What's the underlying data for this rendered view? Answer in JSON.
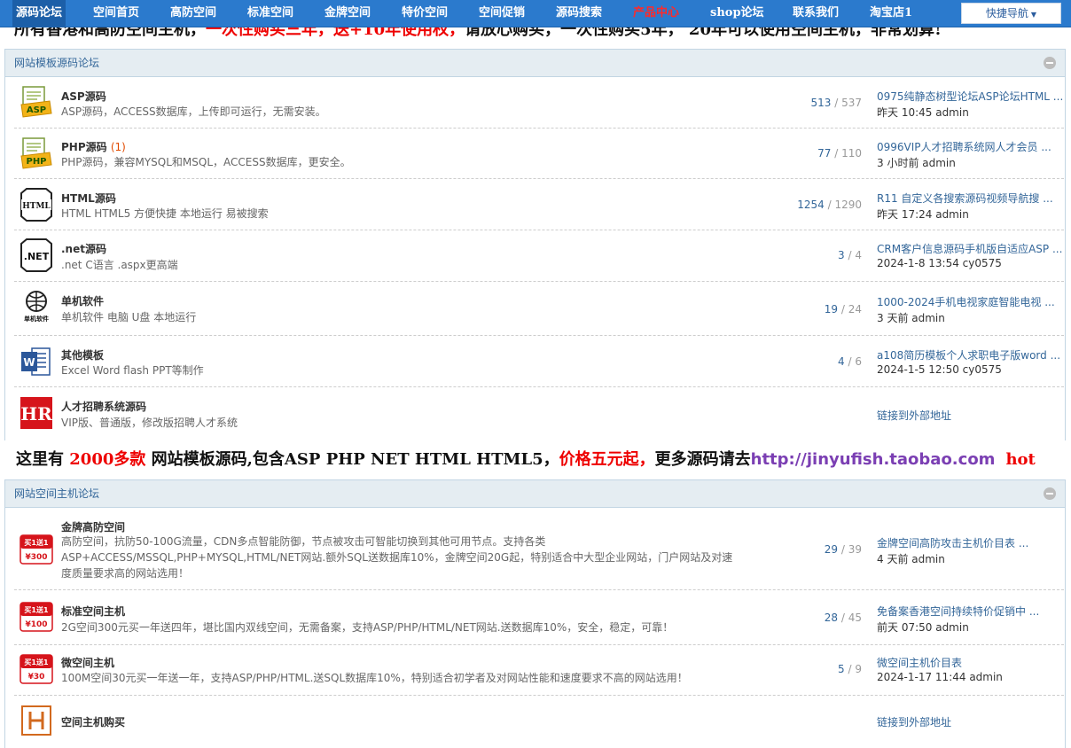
{
  "nav": {
    "items": [
      {
        "label": "源码论坛",
        "active": true
      },
      {
        "label": "空间首页"
      },
      {
        "label": "高防空间"
      },
      {
        "label": "标准空间"
      },
      {
        "label": "金牌空间"
      },
      {
        "label": "特价空间"
      },
      {
        "label": "空间促销"
      },
      {
        "label": "源码搜索"
      },
      {
        "label": "产品中心",
        "hot": true
      },
      {
        "label": "shop论坛"
      },
      {
        "label": "联系我们"
      },
      {
        "label": "淘宝店1"
      }
    ],
    "quick_nav_label": "快捷导航"
  },
  "banner1": {
    "part1": "所有香港和高防空间主机，",
    "part2": "一次性购买三年，送+10年使用权，",
    "part3": "请放心购买，一次性购买5年， 20年可以使用空间主机，非常划算!"
  },
  "section1": {
    "title": "网站模板源码论坛",
    "forums": [
      {
        "icon": "asp-icon",
        "name": "ASP源码",
        "desc": "ASP源码，ACCESS数据库，上传即可运行，无需安装。",
        "threads": "513",
        "posts": "537",
        "last_title": "0975纯静态树型论坛ASP论坛HTML ...",
        "last_meta": "昨天 10:45 admin"
      },
      {
        "icon": "php-icon",
        "name": "PHP源码",
        "count": "(1)",
        "desc": "PHP源码，兼容MYSQL和MSQL，ACCESS数据库，更安全。",
        "threads": "77",
        "posts": "110",
        "last_title": "0996VIP人才招聘系统网人才会员 ...",
        "last_meta": "3 小时前 admin"
      },
      {
        "icon": "html-icon",
        "name": "HTML源码",
        "desc": "HTML HTML5 方便快捷 本地运行 易被搜索",
        "threads": "1254",
        "posts": "1290",
        "last_title": "R11 自定义各搜索源码视频导航搜 ...",
        "last_meta": "昨天 17:24 admin"
      },
      {
        "icon": "net-icon",
        "name": ".net源码",
        "desc": ".net C语言 .aspx更高端",
        "threads": "3",
        "posts": "4",
        "last_title": "CRM客户信息源码手机版自适应ASP ...",
        "last_meta": "2024-1-8 13:54 cy0575"
      },
      {
        "icon": "software-icon",
        "name": "单机软件",
        "desc": "单机软件 电脑 U盘 本地运行",
        "threads": "19",
        "posts": "24",
        "last_title": "1000-2024手机电视家庭智能电视 ...",
        "last_meta": "3 天前 admin"
      },
      {
        "icon": "word-icon",
        "name": "其他模板",
        "desc": "Excel Word flash PPT等制作",
        "threads": "4",
        "posts": "6",
        "last_title": "a108简历模板个人求职电子版word ...",
        "last_meta": "2024-1-5 12:50 cy0575"
      },
      {
        "icon": "hr-icon",
        "name": "人才招聘系统源码",
        "desc": "VIP版、普通版，修改版招聘人才系统",
        "ext": "链接到外部地址"
      }
    ]
  },
  "banner2": {
    "p1": "这里有 ",
    "p2": "2000多款",
    "p3": " 网站模板源码,包含ASP PHP NET HTML HTML5，",
    "p4": "价格五元起，",
    "p5": "更多源码请去",
    "link": "http://jinyufish.taobao.com",
    "hot": "hot"
  },
  "section2": {
    "title": "网站空间主机论坛",
    "forums": [
      {
        "icon": "buy1get1-icon",
        "badge_price": "¥300",
        "name": "金牌高防空间",
        "desc": "高防空间，抗防50-100G流量，CDN多点智能防御，节点被攻击可智能切换到其他可用节点。支持各类ASP+ACCESS/MSSQL,PHP+MYSQL,HTML/NET网站.额外SQL送数据库10%，金牌空间20G起，特别适合中大型企业网站，门户网站及对速度质量要求高的网站选用！",
        "threads": "29",
        "posts": "39",
        "last_title": "金牌空间高防攻击主机价目表 ...",
        "last_meta": "4 天前 admin"
      },
      {
        "icon": "buy1get1-icon",
        "badge_price": "¥100",
        "name": "标准空间主机",
        "desc": "2G空间300元买一年送四年，堪比国内双线空间，无需备案，支持ASP/PHP/HTML/NET网站.送数据库10%，安全，稳定，可靠！",
        "threads": "28",
        "posts": "45",
        "last_title": "免备案香港空间持续特价促销中 ...",
        "last_meta": "前天 07:50 admin"
      },
      {
        "icon": "buy1get1-icon",
        "badge_price": "¥30",
        "name": "微空间主机",
        "desc": "100M空间30元买一年送一年，支持ASP/PHP/HTML.送SQL数据库10%，特别适合初学者及对网站性能和速度要求不高的网站选用！",
        "threads": "5",
        "posts": "9",
        "last_title": "微空间主机价目表",
        "last_meta": "2024-1-17 11:44 admin"
      },
      {
        "icon": "h-letter-icon",
        "name": "空间主机购买",
        "ext": "链接到外部地址"
      }
    ]
  },
  "badge_text": "买1送1",
  "colors": {
    "nav_bg": "#2b7acd",
    "link": "#336699",
    "accent_red": "#e00000"
  }
}
